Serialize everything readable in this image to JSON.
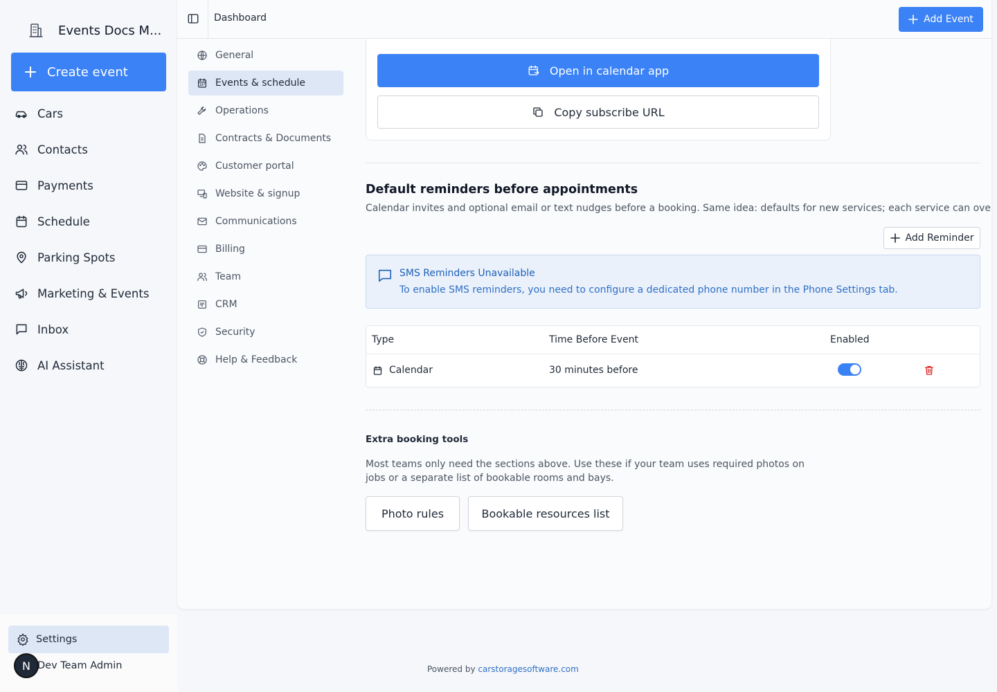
{
  "app": {
    "name": "Events Docs M..."
  },
  "sidebar": {
    "create_label": "Create event",
    "items": [
      {
        "label": "Cars",
        "icon": "car-icon"
      },
      {
        "label": "Contacts",
        "icon": "users-icon"
      },
      {
        "label": "Payments",
        "icon": "credit-card-icon"
      },
      {
        "label": "Schedule",
        "icon": "calendar-icon"
      },
      {
        "label": "Parking Spots",
        "icon": "map-pin-icon"
      },
      {
        "label": "Marketing & Events",
        "icon": "megaphone-icon"
      },
      {
        "label": "Inbox",
        "icon": "message-icon"
      },
      {
        "label": "AI Assistant",
        "icon": "brain-icon"
      }
    ],
    "settings_label": "Settings",
    "user": {
      "initial": "N",
      "name": "Dev Team Admin"
    }
  },
  "topbar": {
    "breadcrumb": "Dashboard",
    "add_event_label": "Add Event"
  },
  "settings_nav": [
    {
      "label": "General",
      "active": false
    },
    {
      "label": "Events & schedule",
      "active": true
    },
    {
      "label": "Operations",
      "active": false
    },
    {
      "label": "Contracts & Documents",
      "active": false
    },
    {
      "label": "Customer portal",
      "active": false
    },
    {
      "label": "Website & signup",
      "active": false
    },
    {
      "label": "Communications",
      "active": false
    },
    {
      "label": "Billing",
      "active": false
    },
    {
      "label": "Team",
      "active": false
    },
    {
      "label": "CRM",
      "active": false
    },
    {
      "label": "Security",
      "active": false
    },
    {
      "label": "Help & Feedback",
      "active": false
    }
  ],
  "calendar_feed": {
    "open_label": "Open in calendar app",
    "copy_label": "Copy subscribe URL"
  },
  "reminders": {
    "title": "Default reminders before appointments",
    "description": "Calendar invites and optional email or text nudges before a booking. Same idea: defaults for new services; each service can override.",
    "add_label": "Add Reminder",
    "alert": {
      "title": "SMS Reminders Unavailable",
      "body": "To enable SMS reminders, you need to configure a dedicated phone number in the Phone Settings tab."
    },
    "table": {
      "headers": {
        "type": "Type",
        "time": "Time Before Event",
        "enabled": "Enabled"
      },
      "rows": [
        {
          "type": "Calendar",
          "time": "30 minutes before",
          "enabled": true
        }
      ]
    }
  },
  "extra_tools": {
    "title": "Extra booking tools",
    "description": "Most teams only need the sections above. Use these if your team uses required photos on jobs or a separate list of bookable rooms and bays.",
    "photo_rules_label": "Photo rules",
    "resources_label": "Bookable resources list"
  },
  "footer": {
    "prefix": "Powered by",
    "link": "carstoragesoftware.com"
  },
  "colors": {
    "accent": "#3b82f6",
    "active_bg": "#dde7f6",
    "danger": "#dc2626"
  }
}
